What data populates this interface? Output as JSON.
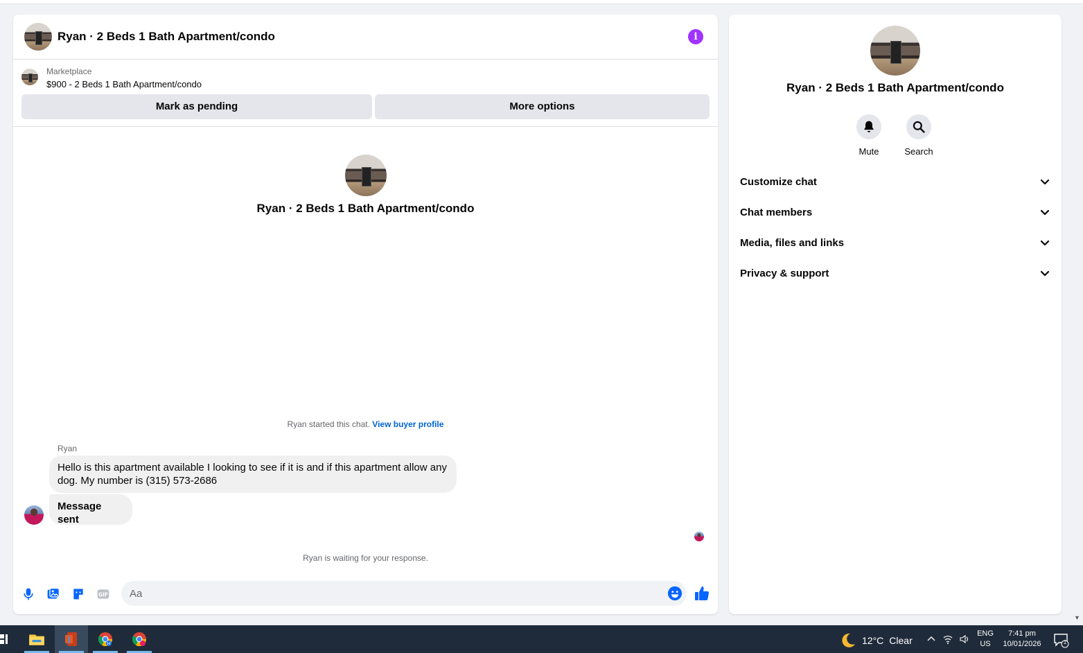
{
  "chat": {
    "title": "Ryan · 2 Beds 1 Bath Apartment/condo",
    "listing": {
      "source": "Marketplace",
      "title": "$900 - 2 Beds 1 Bath Apartment/condo"
    },
    "buttons": {
      "pending": "Mark as pending",
      "more": "More options"
    },
    "intro_title": "Ryan · 2 Beds 1 Bath Apartment/condo",
    "started_text": "Ryan started this chat.",
    "view_profile": "View buyer profile",
    "messages": [
      {
        "sender": "Ryan",
        "text": "Hello is this apartment available I looking to see if it is and if this apartment allow any dog. My number is (315) 573-2686"
      },
      {
        "sender": "",
        "text": "Message sent"
      }
    ],
    "waiting_text": "Ryan is waiting for your response.",
    "composer": {
      "placeholder": "Aa"
    }
  },
  "side": {
    "title": "Ryan · 2 Beds 1 Bath Apartment/condo",
    "actions": {
      "mute": "Mute",
      "search": "Search"
    },
    "sections": [
      "Customize chat",
      "Chat members",
      "Media, files and links",
      "Privacy & support"
    ]
  },
  "taskbar": {
    "weather": {
      "temp": "12°C",
      "condition": "Clear"
    },
    "lang": {
      "line1": "ENG",
      "line2": "US"
    },
    "clock": {
      "time": "7:41 pm",
      "date": "10/01/2026"
    },
    "notifications": "1"
  },
  "colors": {
    "accent": "#0084ff",
    "info": "#a033ff",
    "link": "#0064d1",
    "taskbar": "#1f2b3a"
  },
  "icons": {
    "info": "info-icon",
    "mic": "microphone-icon",
    "image": "image-icon",
    "sticker": "sticker-icon",
    "gif": "gif-icon",
    "emoji": "emoji-icon",
    "like": "thumbs-up-icon",
    "mute": "bell-icon",
    "search": "search-icon",
    "chevron": "chevron-down-icon"
  }
}
